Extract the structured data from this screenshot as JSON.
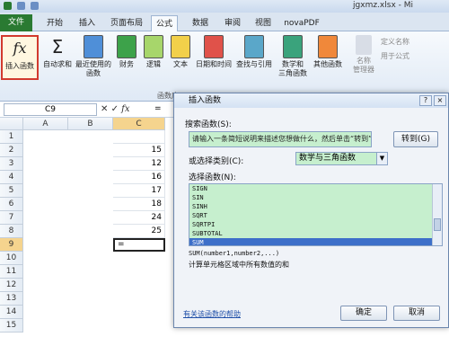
{
  "window": {
    "title": "jgxmz.xlsx - Mi"
  },
  "tabs": [
    "文件",
    "开始",
    "插入",
    "页面布局",
    "公式",
    "数据",
    "审阅",
    "视图",
    "novaPDF"
  ],
  "ribbon": {
    "insert_function": "插入函数",
    "autosum": "自动求和",
    "recent_line1": "最近使用的",
    "recent_line2": "函数",
    "financial": "财务",
    "logical": "逻辑",
    "text": "文本",
    "datetime": "日期和时间",
    "lookup": "查找与引用",
    "math_line1": "数学和",
    "math_line2": "三角函数",
    "other": "其他函数",
    "names_manager_line1": "名称",
    "names_manager_line2": "管理器",
    "define_name": "定义名称",
    "use_in_formula": "用于公式",
    "group_library": "函数库",
    "fx_symbol": "fx",
    "sigma_symbol": "Σ"
  },
  "formula_bar": {
    "name_box": "C9",
    "fx": "fx",
    "equals": "="
  },
  "grid": {
    "columns": [
      "A",
      "B",
      "C"
    ],
    "rows": [
      "1",
      "2",
      "3",
      "4",
      "5",
      "6",
      "7",
      "8",
      "9",
      "10",
      "11",
      "12",
      "13",
      "14",
      "15"
    ],
    "c_values": [
      "",
      "15",
      "12",
      "16",
      "17",
      "18",
      "24",
      "25",
      "="
    ]
  },
  "dialog": {
    "title": "插入函数",
    "help_button": "?",
    "close_button": "×",
    "search_label": "搜索函数(S):",
    "search_placeholder": "请输入一条简短说明来描述您想做什么，然后单击“转到”",
    "goto_button": "转到(G)",
    "category_label": "或选择类别(C):",
    "category_value": "数学与三角函数",
    "select_label": "选择函数(N):",
    "functions": [
      "SIGN",
      "SIN",
      "SINH",
      "SQRT",
      "SQRTPI",
      "SUBTOTAL",
      "SUM"
    ],
    "selected_function": "SUM",
    "signature": "SUM(number1,number2,...)",
    "description": "计算单元格区域中所有数值的和",
    "help_link": "有关该函数的帮助",
    "ok_button": "确定",
    "cancel_button": "取消"
  },
  "colors": {
    "file_tab": "#2a7a32",
    "highlight_border": "#d23a2e",
    "dialog_field": "#c6efce",
    "selection": "#3d6fc9"
  }
}
